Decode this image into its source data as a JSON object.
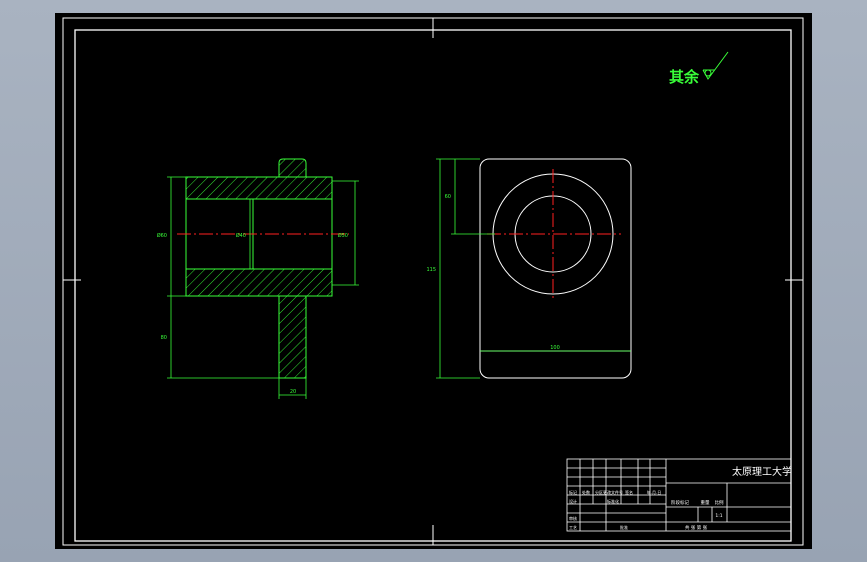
{
  "roughness_note": "其余",
  "dimensions": {
    "left_height_top": "Ø60",
    "left_bore": "Ø40",
    "left_height_right": "Ø50",
    "left_lower": "80",
    "left_flange_width": "20",
    "right_height": "115",
    "right_center": "60",
    "right_width": "100"
  },
  "title_block": {
    "school": "太原理工大学",
    "row_labels": [
      "标记",
      "处数",
      "分区",
      "更改文件号",
      "签名",
      "年.月.日"
    ],
    "design": "设计",
    "standardize": "标准化",
    "stage_mark": "阶段标记",
    "weight": "重量",
    "scale": "比例",
    "scale_value": "1:1",
    "review": "审核",
    "process": "工艺",
    "approve": "批准",
    "sheets": "共  张  第  张"
  },
  "colors": {
    "outline": "#ffffff",
    "geometry": "#39ff39",
    "centerline": "#ff2020",
    "hatch": "#39ff39"
  }
}
